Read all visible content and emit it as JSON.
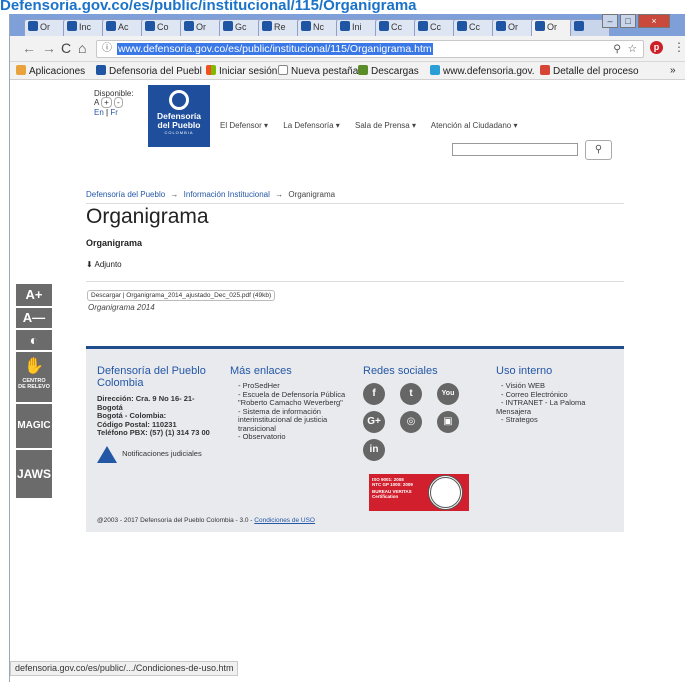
{
  "top_caption": "Defensoria.gov.co/es/public/institucional/115/Organigrama",
  "tabs": [
    "Or",
    "Inc",
    "Ac",
    "Co",
    "Or",
    "Gc",
    "Re",
    "Nc",
    "Ini",
    "Cc",
    "Cc",
    "Cc",
    "Or",
    "Or",
    ""
  ],
  "window_controls": {
    "minimize": "–",
    "maximize": "□",
    "close": "×"
  },
  "url": "www.defensoria.gov.co/es/public/institucional/115/Organigrama.htm",
  "bookmarks": [
    "Aplicaciones",
    "Defensoria del Puebl",
    "Iniciar sesión",
    "Nueva pestaña",
    "Descargas",
    "www.defensoria.gov.",
    "Detalle del proceso",
    "»"
  ],
  "header": {
    "disponible": "Disponible:",
    "lang_size": "A",
    "lang_links": [
      "En",
      "Fr"
    ],
    "logo_lines": [
      "Defensoría",
      "del Pueblo",
      "COLOMBIA"
    ],
    "menu": [
      "El Defensor ▾",
      "La Defensoría ▾",
      "Sala de Prensa ▾",
      "Atención al Ciudadano ▾"
    ],
    "search_placeholder": ""
  },
  "breadcrumb": [
    "Defensoría del Pueblo",
    "→",
    "Información Institucional",
    "→",
    "Organigrama"
  ],
  "main": {
    "title": "Organigrama",
    "subtitle": "Organigrama",
    "adjunto": "Adjunto",
    "download_label": "Descargar | Organigrama_2014_ajustado_Dec_025.pdf (49kb)",
    "caption": "Organigrama 2014"
  },
  "sidebar": {
    "a_plus": "A+",
    "a_minus": "A—",
    "contrast": "◐",
    "relevo": "CENTRO DE RELEVO",
    "magic": "MAGIC",
    "jaws": "JAWS"
  },
  "footer": {
    "org_title": "Defensoría del Pueblo Colombia",
    "address": [
      "Dirección: Cra. 9 No 16- 21- Bogotá",
      "Bogotá - Colombia:",
      "Código Postal: 110231",
      "Teléfono PBX: (57) (1) 314 73 00"
    ],
    "notif": "Notificaciones judiciales",
    "mas_title": "Más enlaces",
    "mas_items": [
      "ProSedHer",
      "Escuela de Defensoría Pública \"Roberto Camacho Weverberg\"",
      "Sistema de información interinstitucional de justicia transicional",
      "Observatorio"
    ],
    "redes_title": "Redes sociales",
    "social": [
      "f",
      "t",
      "You",
      "G+",
      "◎",
      "▣",
      "in"
    ],
    "uso_title": "Uso interno",
    "uso_items": [
      "Visión WEB",
      "Correo Electrónico",
      "INTRANET - La Paloma",
      "Mensajera",
      "Strategos"
    ],
    "iso": [
      "ISO 9001: 2008",
      "NTC GP 1000: 2009",
      "BUREAU VERITAS",
      "Certification"
    ],
    "copyright": "@2003 - 2017 Defensoría del Pueblo Colombia - 3.0 - ",
    "condiciones": "Condiciones de USO"
  },
  "status_url": "defensoria.gov.co/es/public/.../Condiciones-de-uso.htm"
}
